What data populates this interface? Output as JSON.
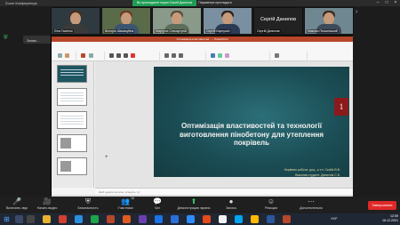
{
  "zoom": {
    "window_title": "Zoom Конференція",
    "share_banner": "Ви проглядаєте екран Сергій Данилов",
    "view_options": "Параметри проглядати",
    "recording_label": "Запис...",
    "participants": [
      {
        "name": "Ліна Гасенко"
      },
      {
        "name": "Вікторія Шмовкуйна"
      },
      {
        "name": "Маргуліс Стасартулій"
      },
      {
        "name": "Сергій Карпушін"
      },
      {
        "name": "Сергій Данилов"
      },
      {
        "name": "Максим Пешинський"
      }
    ],
    "highlight_name": "Сергій Данилов",
    "toolbar": {
      "items": [
        {
          "icon": "microphone-icon",
          "label": "Включить звук"
        },
        {
          "icon": "video-icon",
          "label": "Начать видео"
        },
        {
          "icon": "shield-icon",
          "label": "Безопасность"
        },
        {
          "icon": "participants-icon",
          "label": "Участники"
        },
        {
          "icon": "chat-icon",
          "label": "Чат"
        },
        {
          "icon": "share-screen-icon",
          "label": "Демонстрация экрана"
        },
        {
          "icon": "record-icon",
          "label": "Запись"
        },
        {
          "icon": "reactions-icon",
          "label": "Реакции"
        },
        {
          "icon": "more-icon",
          "label": "Дополнительно"
        }
      ],
      "end_label": "Завершение",
      "participant_count": "16"
    }
  },
  "powerpoint": {
    "window_title": "Оптимізація властивостей ... - PowerPoint",
    "notes_placeholder": "Щоб додати нотатки, клацніть тут",
    "slide": {
      "number": "1",
      "title": "Оптимізація властивостей та технології виготовлення пінобетону для утеплення покрівель",
      "author_line1": "Керівник роботи: доц., к.т.н. Скоба В.В.",
      "author_line2": "Виконав студент: Данилов С.Б."
    }
  },
  "taskbar": {
    "time": "12:59",
    "date": "16.12.2021",
    "language": "УКР"
  },
  "colors": {
    "ppt_accent": "#b7472a",
    "slide_bg": "#1b4d55",
    "end_button": "#e02828"
  }
}
